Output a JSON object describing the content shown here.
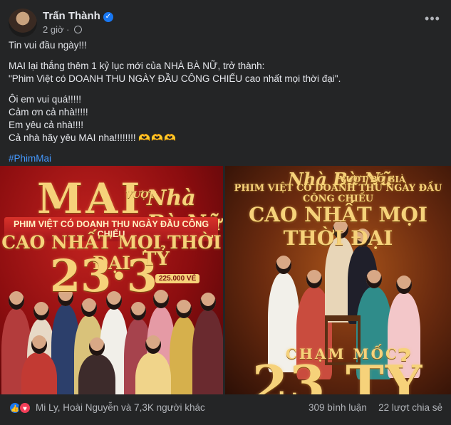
{
  "post": {
    "author": "Trấn Thành",
    "timestamp": "2 giờ",
    "privacy_icon": "globe-icon",
    "verified_icon": "verified-badge-icon",
    "more_icon": "more-options-icon"
  },
  "body": {
    "line1": "Tin vui đầu ngày!!!",
    "line2": "MAI lại thắng thêm 1 kỷ lục mới của NHÀ BÀ NỮ, trở thành:",
    "line3": " \"Phim Việt có DOANH THU NGÀY ĐẦU CÔNG CHIẾU cao nhất mọi thời đại\".",
    "line4": "Ôi em vui quá!!!!!",
    "line5": "Cảm ơn cả nhà!!!!!",
    "line6": "Em yêu cả nhà!!!!",
    "line7": "Cả nhà hãy yêu MAI nha!!!!!!!! ",
    "hearts": "🫶🫶🫶",
    "hashtag": "#PhimMai"
  },
  "poster_left": {
    "title": "MAI",
    "surpass_label": "VƯỢT",
    "brand": "Nhà Bà Nữ",
    "tagline": "PHIM VIỆT CÓ DOANH THU NGÀY ĐẦU CÔNG CHIẾU",
    "headline": "CAO NHẤT MỌI THỜI ĐẠI",
    "amount": "23·3",
    "unit": "TỶ",
    "tickets": "225.000 VÉ"
  },
  "poster_right": {
    "brand": "Nhà Bà Nữ",
    "surpass_label": "VƯỢT BỐ GIÀ",
    "tagline": "PHIM VIỆT CÓ DOANH THU NGÀY ĐẦU CÔNG CHIẾU",
    "headline": "CAO NHẤT MỌI THỜI ĐẠI",
    "milestone": "CHẠM MỐC",
    "amount": "23 TỶ"
  },
  "footer": {
    "like_icon": "like-reaction-icon",
    "love_icon": "love-reaction-icon",
    "reactions_text": "Mi Ly, Hoài Nguyễn và 7,3K người khác",
    "comments_text": "309 bình luận",
    "shares_text": "22 lượt chia sẻ"
  },
  "colors": {
    "background": "#242526",
    "text_primary": "#e4e6eb",
    "text_secondary": "#b0b3b8",
    "hashtag": "#4599ff",
    "verified": "#1877f2",
    "poster_red": "#8b0d0f",
    "poster_gold": "#f6d27a"
  }
}
